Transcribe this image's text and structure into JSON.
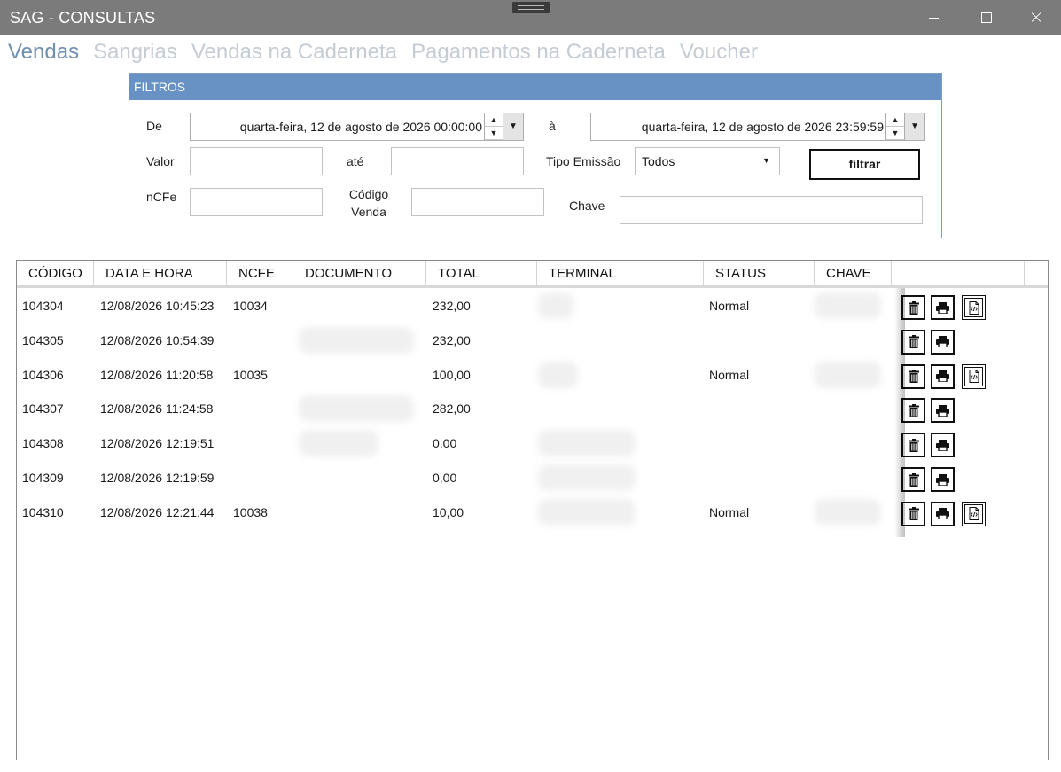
{
  "window": {
    "title": "SAG - CONSULTAS"
  },
  "tabs": [
    {
      "label": "Vendas",
      "active": true
    },
    {
      "label": "Sangrias",
      "active": false
    },
    {
      "label": "Vendas na Caderneta",
      "active": false
    },
    {
      "label": "Pagamentos na Caderneta",
      "active": false
    },
    {
      "label": "Voucher",
      "active": false
    }
  ],
  "filters": {
    "header": "FILTROS",
    "de_label": "De",
    "de_value": "quarta-feira, 12 de agosto de 2026 00:00:00",
    "a_label": "à",
    "a_value": "quarta-feira, 12 de agosto de 2026 23:59:59",
    "valor_label": "Valor",
    "ate_label": "até",
    "tipo_emissao_label": "Tipo Emissão",
    "tipo_emissao_value": "Todos",
    "filtrar_label": "filtrar",
    "ncfe_label": "nCFe",
    "codigo_venda_label": "Código Venda",
    "chave_label": "Chave"
  },
  "grid": {
    "columns": [
      "CÓDIGO",
      "DATA E HORA",
      "NCFE",
      "DOCUMENTO",
      "TOTAL",
      "TERMINAL",
      "STATUS",
      "CHAVE"
    ],
    "rows": [
      {
        "codigo": "104304",
        "data_hora": "12/08/2026 10:45:23",
        "ncfe": "10034",
        "total": "232,00",
        "status": "Normal",
        "xml": true
      },
      {
        "codigo": "104305",
        "data_hora": "12/08/2026 10:54:39",
        "ncfe": "",
        "total": "232,00",
        "status": "",
        "xml": false
      },
      {
        "codigo": "104306",
        "data_hora": "12/08/2026 11:20:58",
        "ncfe": "10035",
        "total": "100,00",
        "status": "Normal",
        "xml": true
      },
      {
        "codigo": "104307",
        "data_hora": "12/08/2026 11:24:58",
        "ncfe": "",
        "total": "282,00",
        "status": "",
        "xml": false
      },
      {
        "codigo": "104308",
        "data_hora": "12/08/2026 12:19:51",
        "ncfe": "",
        "total": "0,00",
        "status": "",
        "xml": false
      },
      {
        "codigo": "104309",
        "data_hora": "12/08/2026 12:19:59",
        "ncfe": "",
        "total": "0,00",
        "status": "",
        "xml": false
      },
      {
        "codigo": "104310",
        "data_hora": "12/08/2026 12:21:44",
        "ncfe": "10038",
        "total": "10,00",
        "status": "Normal",
        "xml": true
      }
    ],
    "row_icons": [
      "trash-icon",
      "printer-icon",
      "xml-file-icon"
    ]
  },
  "colors": {
    "titlebar": "#7b7b7b",
    "tab_active": "#6f8fb0",
    "tab_inactive": "#c6ccd3",
    "filter_header": "#6792c3"
  }
}
